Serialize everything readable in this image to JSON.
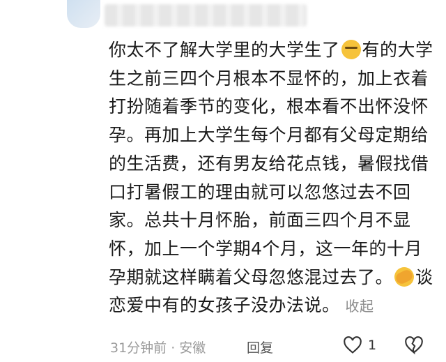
{
  "comment": {
    "segments": [
      {
        "type": "text",
        "value": "你太不了解大学里的大学生了"
      },
      {
        "type": "emoji",
        "name": "thinking-emoji"
      },
      {
        "type": "text",
        "value": "有的大学生之前三四个月根本不显怀的，加上衣着打扮随着季节的变化，根本看不出怀没怀孕。再加上大学生每个月都有父母定期给的生活费，还有男友给花点钱，暑假找借口打暑假工的理由就可以忽悠过去不回家。总共十月怀胎，前面三四个月不显怀，加上一个学期4个月，这一年的十月孕期就这样瞒着父母忽悠混过去了。"
      },
      {
        "type": "emoji",
        "name": "facepalm-emoji"
      },
      {
        "type": "text",
        "value": "谈恋爱中有的女孩子没办法说。"
      }
    ],
    "collapse_label": "收起"
  },
  "footer": {
    "time_location": "31分钟前 · 安徽",
    "reply_label": "回复",
    "like_count": "1"
  },
  "icons": {
    "like": "heart-outline-icon",
    "dislike": "broken-heart-icon"
  }
}
